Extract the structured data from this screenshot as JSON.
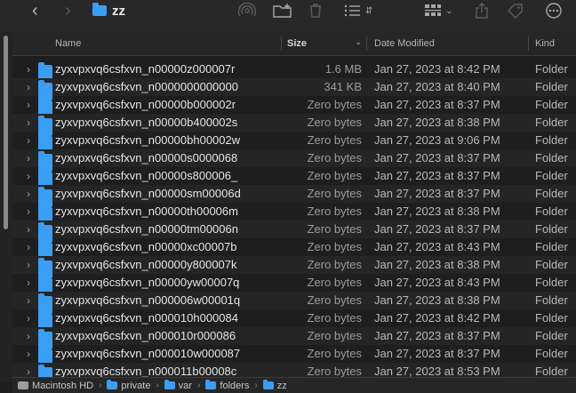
{
  "window": {
    "title": "zz"
  },
  "toolbar": {
    "back_icon": "chevron-left",
    "forward_icon": "chevron-right",
    "airdrop_icon": "airdrop",
    "new_folder_icon": "folder-plus",
    "trash_icon": "trash",
    "list_view_icon": "list",
    "group_icon": "grid",
    "share_icon": "share",
    "tag_icon": "tag",
    "more_icon": "ellipsis-circle"
  },
  "columns": {
    "name": "Name",
    "size": "Size",
    "date": "Date Modified",
    "kind": "Kind"
  },
  "rows": [
    {
      "name": "zyxvpxvq6csfxvn_n00000z000007r",
      "size": "1.6 MB",
      "date": "Jan 27, 2023 at 8:42 PM",
      "kind": "Folder"
    },
    {
      "name": "zyxvpxvq6csfxvn_n0000000000000",
      "size": "341 KB",
      "date": "Jan 27, 2023 at 8:40 PM",
      "kind": "Folder"
    },
    {
      "name": "zyxvpxvq6csfxvn_n00000b000002r",
      "size": "Zero bytes",
      "date": "Jan 27, 2023 at 8:37 PM",
      "kind": "Folder"
    },
    {
      "name": "zyxvpxvq6csfxvn_n00000b400002s",
      "size": "Zero bytes",
      "date": "Jan 27, 2023 at 8:38 PM",
      "kind": "Folder"
    },
    {
      "name": "zyxvpxvq6csfxvn_n00000bh00002w",
      "size": "Zero bytes",
      "date": "Jan 27, 2023 at 9:06 PM",
      "kind": "Folder"
    },
    {
      "name": "zyxvpxvq6csfxvn_n00000s0000068",
      "size": "Zero bytes",
      "date": "Jan 27, 2023 at 8:37 PM",
      "kind": "Folder"
    },
    {
      "name": "zyxvpxvq6csfxvn_n00000s800006_",
      "size": "Zero bytes",
      "date": "Jan 27, 2023 at 8:37 PM",
      "kind": "Folder"
    },
    {
      "name": "zyxvpxvq6csfxvn_n00000sm00006d",
      "size": "Zero bytes",
      "date": "Jan 27, 2023 at 8:37 PM",
      "kind": "Folder"
    },
    {
      "name": "zyxvpxvq6csfxvn_n00000th00006m",
      "size": "Zero bytes",
      "date": "Jan 27, 2023 at 8:38 PM",
      "kind": "Folder"
    },
    {
      "name": "zyxvpxvq6csfxvn_n00000tm00006n",
      "size": "Zero bytes",
      "date": "Jan 27, 2023 at 8:37 PM",
      "kind": "Folder"
    },
    {
      "name": "zyxvpxvq6csfxvn_n00000xc00007b",
      "size": "Zero bytes",
      "date": "Jan 27, 2023 at 8:43 PM",
      "kind": "Folder"
    },
    {
      "name": "zyxvpxvq6csfxvn_n00000y800007k",
      "size": "Zero bytes",
      "date": "Jan 27, 2023 at 8:38 PM",
      "kind": "Folder"
    },
    {
      "name": "zyxvpxvq6csfxvn_n00000yw00007q",
      "size": "Zero bytes",
      "date": "Jan 27, 2023 at 8:43 PM",
      "kind": "Folder"
    },
    {
      "name": "zyxvpxvq6csfxvn_n000006w00001q",
      "size": "Zero bytes",
      "date": "Jan 27, 2023 at 8:38 PM",
      "kind": "Folder"
    },
    {
      "name": "zyxvpxvq6csfxvn_n000010h000084",
      "size": "Zero bytes",
      "date": "Jan 27, 2023 at 8:42 PM",
      "kind": "Folder"
    },
    {
      "name": "zyxvpxvq6csfxvn_n000010r000086",
      "size": "Zero bytes",
      "date": "Jan 27, 2023 at 8:37 PM",
      "kind": "Folder"
    },
    {
      "name": "zyxvpxvq6csfxvn_n000010w000087",
      "size": "Zero bytes",
      "date": "Jan 27, 2023 at 8:37 PM",
      "kind": "Folder"
    },
    {
      "name": "zyxvpxvq6csfxvn_n000011b00008c",
      "size": "Zero bytes",
      "date": "Jan 27, 2023 at 8:53 PM",
      "kind": "Folder"
    }
  ],
  "pathbar": [
    {
      "label": "Macintosh HD",
      "icon": "hard-drive"
    },
    {
      "label": "private",
      "icon": "folder"
    },
    {
      "label": "var",
      "icon": "folder"
    },
    {
      "label": "folders",
      "icon": "folder"
    },
    {
      "label": "zz",
      "icon": "folder"
    }
  ],
  "colors": {
    "accent_folder": "#3a9ef5",
    "background": "#1e1e1e"
  }
}
